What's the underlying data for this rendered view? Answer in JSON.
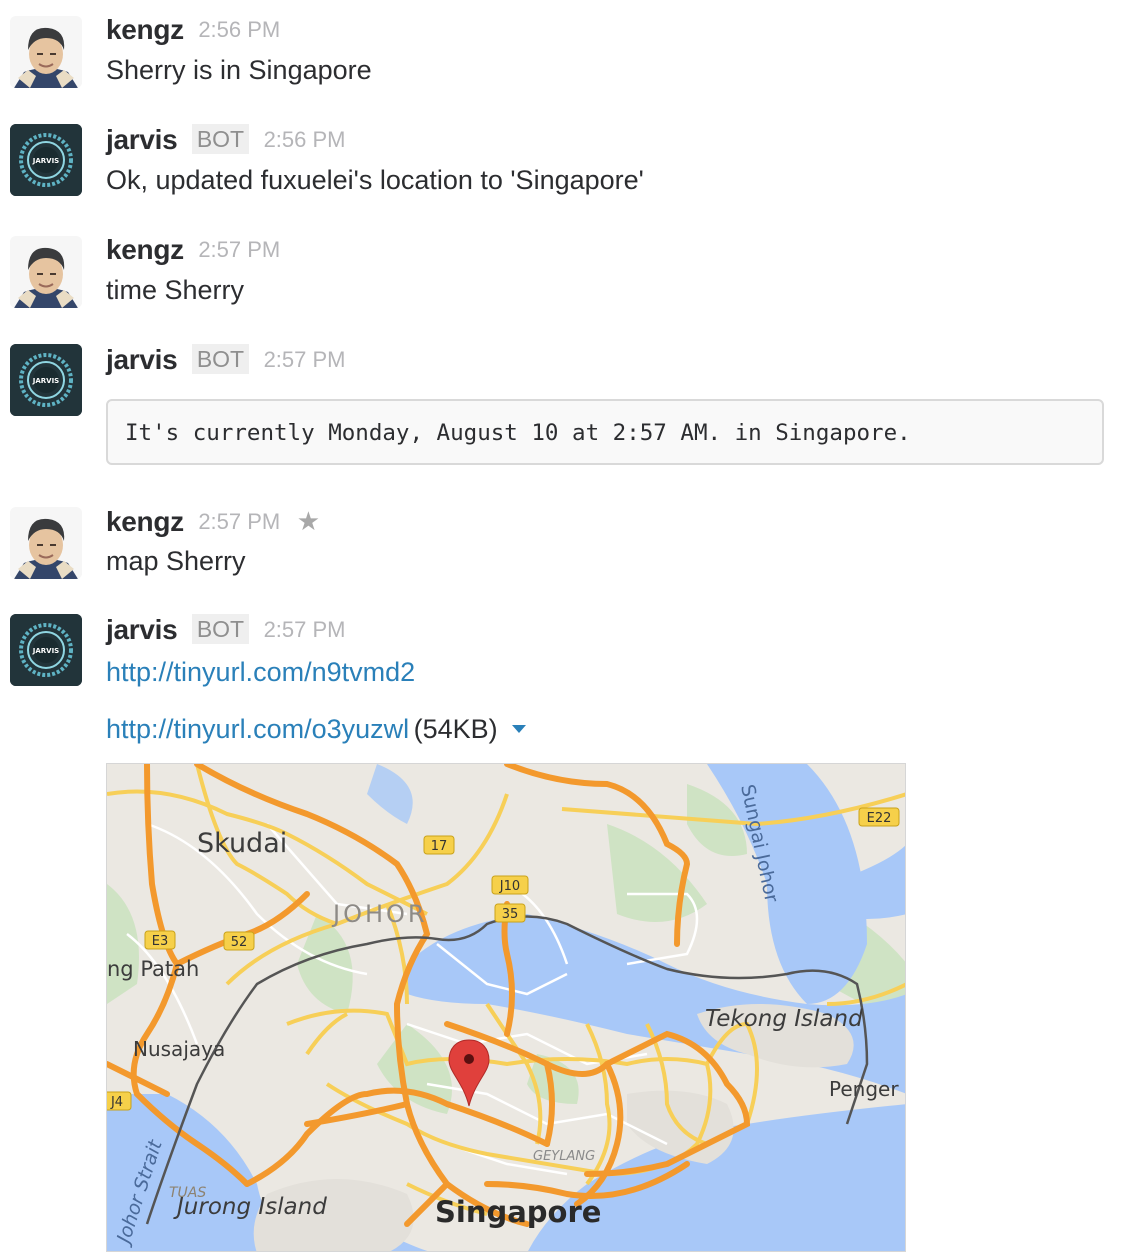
{
  "messages": [
    {
      "sender": "kengz",
      "is_bot": false,
      "timestamp": "2:56 PM",
      "text": "Sherry is in Singapore"
    },
    {
      "sender": "jarvis",
      "is_bot": true,
      "bot_badge": "BOT",
      "timestamp": "2:56 PM",
      "text": "Ok, updated fuxuelei's location to 'Singapore'"
    },
    {
      "sender": "kengz",
      "is_bot": false,
      "timestamp": "2:57 PM",
      "text": "time Sherry"
    },
    {
      "sender": "jarvis",
      "is_bot": true,
      "bot_badge": "BOT",
      "timestamp": "2:57 PM",
      "code_block": "It's currently Monday, August 10 at 2:57 AM. in Singapore."
    },
    {
      "sender": "kengz",
      "is_bot": false,
      "timestamp": "2:57 PM",
      "starred_icon": "star-icon",
      "text": "map Sherry"
    },
    {
      "sender": "jarvis",
      "is_bot": true,
      "bot_badge": "BOT",
      "timestamp": "2:57 PM",
      "link": "http://tinyurl.com/n9tvmd2",
      "attachment": {
        "url": "http://tinyurl.com/o3yuzwl",
        "size": "(54KB)",
        "dropdown_icon": "caret-down-icon"
      }
    }
  ],
  "avatars": {
    "kengz_label": "",
    "jarvis_label": "JARVIS"
  },
  "map": {
    "labels": {
      "skudai": "Skudai",
      "johor": "JOHOR",
      "gelang_patah": "ng Patah",
      "nusajaya": "Nusajaya",
      "johor_strait": "Johor Strait",
      "tuas": "TUAS",
      "jurong_island": "Jurong Island",
      "singapore": "Singapore",
      "geylang": "GEYLANG",
      "tekong_island": "Tekong Island",
      "pengerang": "Penger",
      "sungai_johor": "Sungai Johor"
    },
    "shields": {
      "e3": "E3",
      "s52": "52",
      "s17": "17",
      "j10": "J10",
      "s35": "35",
      "e22": "E22",
      "j4": "J4"
    },
    "pin_icon": "map-pin-icon",
    "colors": {
      "water": "#a8c8f8",
      "land": "#ebe8e2",
      "park": "#cfe3c4",
      "highway": "#f3992d",
      "major_road": "#f7cf58",
      "border": "#555555",
      "pin": "#e0403c"
    }
  },
  "colors": {
    "link": "#2a80b9",
    "timestamp": "#b5b5b8",
    "bot_badge_bg": "#efefef"
  }
}
